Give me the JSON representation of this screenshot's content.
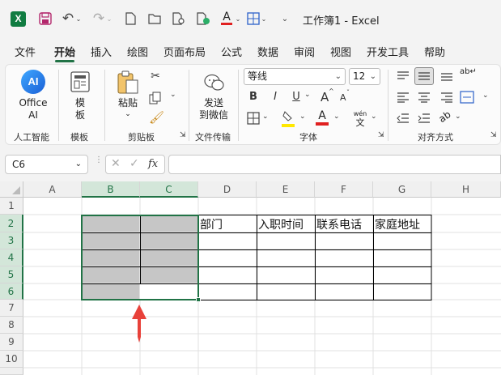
{
  "window": {
    "title": "工作簿1 - Excel"
  },
  "tabs": [
    "文件",
    "开始",
    "插入",
    "绘图",
    "页面布局",
    "公式",
    "数据",
    "审阅",
    "视图",
    "开发工具",
    "帮助"
  ],
  "active_tab": "开始",
  "ribbon": {
    "ai": {
      "logo": "AI",
      "label1": "Office",
      "label2": "AI",
      "group": "人工智能"
    },
    "template": {
      "label1": "模",
      "label2": "板",
      "group": "模板"
    },
    "clipboard": {
      "paste": "粘贴",
      "group": "剪贴板"
    },
    "transfer": {
      "label1": "发送",
      "label2": "到微信",
      "group": "文件传输"
    },
    "font": {
      "name": "等线",
      "size": "12",
      "bold": "B",
      "italic": "I",
      "underline": "U",
      "grow": "A",
      "shrink": "A",
      "fontcolor": "A",
      "wen_top": "wén",
      "wen_bottom": "文",
      "group": "字体"
    },
    "align": {
      "wrap": "ab↵",
      "group": "对齐方式"
    }
  },
  "formula_bar": {
    "name_box": "C6",
    "fx": "fx"
  },
  "sheet": {
    "columns": [
      "A",
      "B",
      "C",
      "D",
      "E",
      "F",
      "G",
      "H"
    ],
    "rows": [
      "1",
      "2",
      "3",
      "4",
      "5",
      "6",
      "7",
      "8",
      "9",
      "10"
    ],
    "active_cell": "C6",
    "table_headers": [
      "部门",
      "入职时间",
      "联系电话",
      "家庭地址"
    ]
  },
  "colors": {
    "accent": "#217346",
    "selection_fill": "#c6c6c6",
    "arrow": "#e8413a",
    "font_color_red": "#e02020",
    "highlight_yellow": "#ffe800"
  }
}
